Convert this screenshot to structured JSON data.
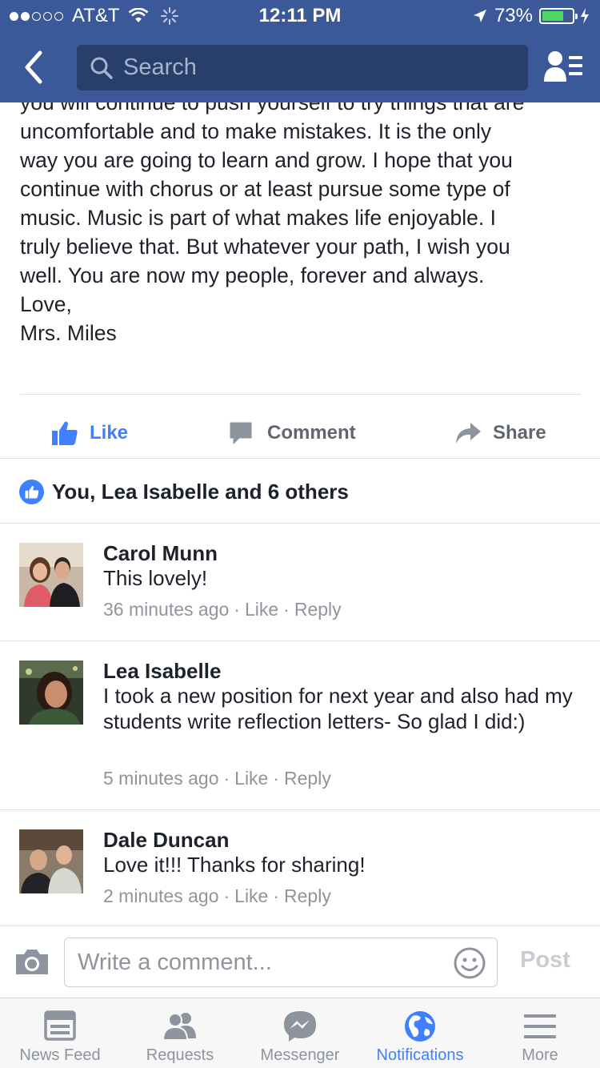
{
  "status_bar": {
    "carrier": "AT&T",
    "time": "12:11 PM",
    "battery": "73%",
    "battery_level": 0.73,
    "signal_bars_filled": 2,
    "signal_bars_total": 5
  },
  "nav": {
    "search_placeholder": "Search"
  },
  "post": {
    "body_top_partial": "you will continue to push yourself to try things that are",
    "body": "uncomfortable and to make mistakes. It is the only\nway you are going to learn and grow. I hope that you\ncontinue with chorus or at least pursue some type of\nmusic. Music is part of what makes life enjoyable. I\ntruly believe that. But whatever your path, I wish you\nwell. You are now my people, forever and always.",
    "signoff": "Love,",
    "signature": "Mrs. Miles"
  },
  "actions": {
    "like": "Like",
    "comment": "Comment",
    "share": "Share"
  },
  "likes_summary": "You, Lea Isabelle and 6 others",
  "comments": [
    {
      "name": "Carol Munn",
      "text": "This lovely!",
      "time": "36 minutes ago",
      "like": "Like",
      "reply": "Reply"
    },
    {
      "name": "Lea Isabelle",
      "text": "I took a new position for next year and also had my students write reflection letters- So glad I did:)",
      "time": "5 minutes ago",
      "like": "Like",
      "reply": "Reply"
    },
    {
      "name": "Dale Duncan",
      "text": "Love it!!!  Thanks for sharing!",
      "time": "2 minutes ago",
      "like": "Like",
      "reply": "Reply"
    }
  ],
  "composer": {
    "placeholder": "Write a comment...",
    "post": "Post"
  },
  "tabs": [
    {
      "label": "News Feed",
      "icon": "news-feed-icon",
      "active": false
    },
    {
      "label": "Requests",
      "icon": "friend-requests-icon",
      "active": false
    },
    {
      "label": "Messenger",
      "icon": "messenger-icon",
      "active": false
    },
    {
      "label": "Notifications",
      "icon": "globe-icon",
      "active": true
    },
    {
      "label": "More",
      "icon": "hamburger-menu-icon",
      "active": false
    }
  ],
  "colors": {
    "brand_blue": "#3b5998",
    "search_bg": "#283e6b",
    "like_blue": "#4080ff",
    "active_tab": "#4080ff",
    "meta_gray": "#90949c",
    "battery_green": "#4cd964"
  }
}
